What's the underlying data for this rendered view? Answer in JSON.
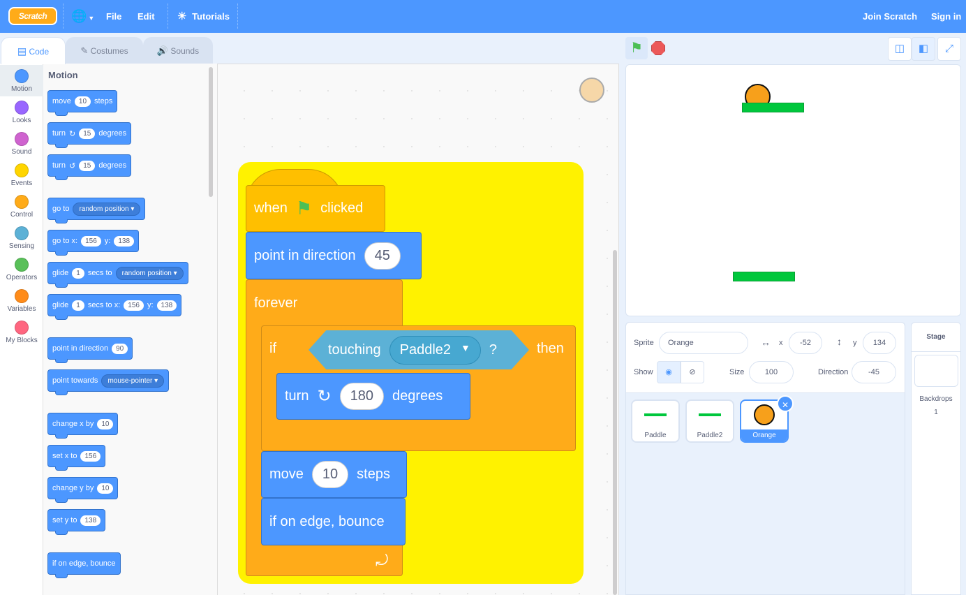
{
  "menubar": {
    "logo": "Scratch",
    "file": "File",
    "edit": "Edit",
    "tutorials": "Tutorials",
    "join": "Join Scratch",
    "signin": "Sign in",
    "icons": [
      "globe-icon",
      "chevron-down-icon",
      "lightbulb-icon"
    ]
  },
  "tabs": [
    {
      "label": "Code",
      "icon": "code-icon"
    },
    {
      "label": "Costumes",
      "icon": "brush-icon"
    },
    {
      "label": "Sounds",
      "icon": "speaker-icon"
    }
  ],
  "categories": [
    {
      "label": "Motion",
      "color": "#4c97ff"
    },
    {
      "label": "Looks",
      "color": "#9966ff"
    },
    {
      "label": "Sound",
      "color": "#cf63cf"
    },
    {
      "label": "Events",
      "color": "#ffd500"
    },
    {
      "label": "Control",
      "color": "#ffab19"
    },
    {
      "label": "Sensing",
      "color": "#5cb1d6"
    },
    {
      "label": "Operators",
      "color": "#59c059"
    },
    {
      "label": "Variables",
      "color": "#ff8c1a"
    },
    {
      "label": "My Blocks",
      "color": "#ff6680"
    }
  ],
  "palette": {
    "title": "Motion",
    "move": {
      "a": "move",
      "n": "10",
      "b": "steps"
    },
    "turn_cw": {
      "a": "turn",
      "n": "15",
      "b": "degrees"
    },
    "turn_ccw": {
      "a": "turn",
      "n": "15",
      "b": "degrees"
    },
    "goto": {
      "a": "go to",
      "d": "random position"
    },
    "gotoxy": {
      "a": "go to x:",
      "x": "156",
      "b": "y:",
      "y": "138"
    },
    "glide": {
      "a": "glide",
      "n": "1",
      "b": "secs to",
      "d": "random position"
    },
    "glidexy": {
      "a": "glide",
      "n": "1",
      "b": "secs to x:",
      "x": "156",
      "c": "y:",
      "y": "138"
    },
    "point": {
      "a": "point in direction",
      "n": "90"
    },
    "towards": {
      "a": "point towards",
      "d": "mouse-pointer"
    },
    "changex": {
      "a": "change x by",
      "n": "10"
    },
    "setx": {
      "a": "set x to",
      "n": "156"
    },
    "changey": {
      "a": "change y by",
      "n": "10"
    },
    "sety": {
      "a": "set y to",
      "n": "138"
    },
    "bounce": "if on edge, bounce"
  },
  "script": {
    "when": "when",
    "clicked": "clicked",
    "point": "point in direction",
    "direction": "45",
    "forever": "forever",
    "if": "if",
    "touching": "touching",
    "target": "Paddle2",
    "q": "?",
    "then": "then",
    "turn": "turn",
    "deg": "180",
    "degrees": "degrees",
    "move": "move",
    "steps_n": "10",
    "steps": "steps",
    "bounce": "if on edge, bounce"
  },
  "sprite": {
    "label": "Sprite",
    "name": "Orange",
    "x_label": "x",
    "x": "-52",
    "y_label": "y",
    "y": "134",
    "show": "Show",
    "size_label": "Size",
    "size": "100",
    "dir_label": "Direction",
    "direction": "-45"
  },
  "sprites": [
    {
      "name": "Paddle"
    },
    {
      "name": "Paddle2"
    },
    {
      "name": "Orange"
    }
  ],
  "stagepanel": {
    "title": "Stage",
    "backdrops": "Backdrops",
    "count": "1"
  }
}
